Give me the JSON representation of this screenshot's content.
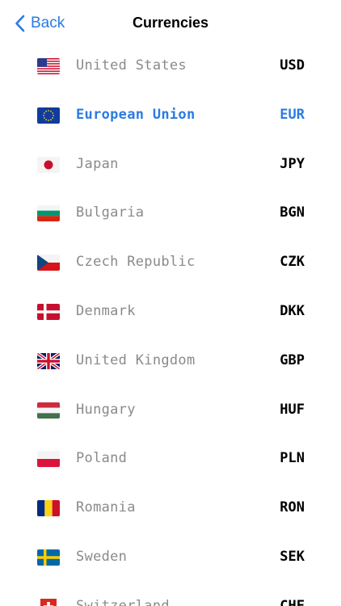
{
  "nav": {
    "back_label": "Back",
    "title": "Currencies"
  },
  "colors": {
    "accent": "#2a7be4",
    "country_text": "#8a8a8a",
    "code_text": "#000000"
  },
  "currencies": [
    {
      "country": "United States",
      "code": "USD",
      "flag_icon": "us-flag-icon",
      "selected": false
    },
    {
      "country": "European Union",
      "code": "EUR",
      "flag_icon": "eu-flag-icon",
      "selected": true
    },
    {
      "country": "Japan",
      "code": "JPY",
      "flag_icon": "jp-flag-icon",
      "selected": false
    },
    {
      "country": "Bulgaria",
      "code": "BGN",
      "flag_icon": "bg-flag-icon",
      "selected": false
    },
    {
      "country": "Czech Republic",
      "code": "CZK",
      "flag_icon": "cz-flag-icon",
      "selected": false
    },
    {
      "country": "Denmark",
      "code": "DKK",
      "flag_icon": "dk-flag-icon",
      "selected": false
    },
    {
      "country": "United Kingdom",
      "code": "GBP",
      "flag_icon": "gb-flag-icon",
      "selected": false
    },
    {
      "country": "Hungary",
      "code": "HUF",
      "flag_icon": "hu-flag-icon",
      "selected": false
    },
    {
      "country": "Poland",
      "code": "PLN",
      "flag_icon": "pl-flag-icon",
      "selected": false
    },
    {
      "country": "Romania",
      "code": "RON",
      "flag_icon": "ro-flag-icon",
      "selected": false
    },
    {
      "country": "Sweden",
      "code": "SEK",
      "flag_icon": "se-flag-icon",
      "selected": false
    },
    {
      "country": "Switzerland",
      "code": "CHF",
      "flag_icon": "ch-flag-icon",
      "selected": false
    }
  ]
}
